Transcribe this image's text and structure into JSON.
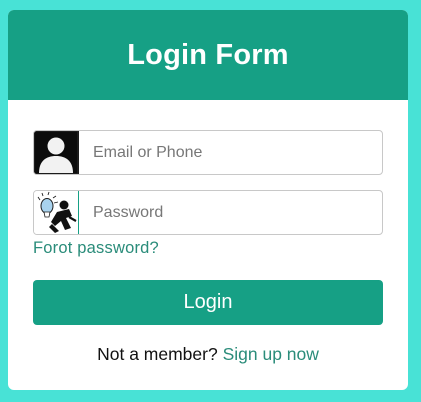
{
  "form": {
    "title": "Login Form",
    "email_placeholder": "Email or Phone",
    "password_placeholder": "Password",
    "forgot_link": "Forot password?",
    "login_button": "Login",
    "member_prompt": "Not a member?",
    "signup_link": "Sign up now"
  },
  "icons": {
    "email": "user-avatar-icon",
    "password": "key-person-icon"
  },
  "colors": {
    "background": "#48e2d6",
    "accent": "#16a085",
    "link": "#2a8c7a"
  }
}
